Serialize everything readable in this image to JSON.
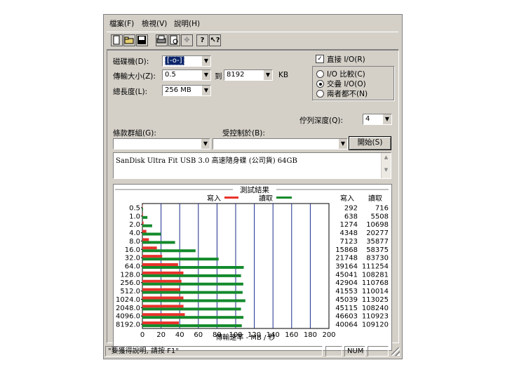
{
  "menu": {
    "file": "檔案(F)",
    "view": "檢視(V)",
    "help": "說明(H)"
  },
  "toolbar": {
    "buttons": [
      {
        "icon": "new-document-icon",
        "glyph": "🗋"
      },
      {
        "icon": "open-folder-icon",
        "glyph": "📂"
      },
      {
        "icon": "save-icon",
        "glyph": "💾"
      },
      {
        "icon": "print-icon",
        "glyph": "🖶"
      },
      {
        "icon": "print-preview-icon",
        "glyph": "🔍"
      },
      {
        "icon": "move-icon",
        "glyph": "✥"
      },
      {
        "icon": "help-icon",
        "glyph": "?"
      },
      {
        "icon": "context-help-icon",
        "glyph": "⁇"
      }
    ]
  },
  "settings": {
    "drive_label": "磁碟機(D):",
    "drive_value": "[-o-]",
    "transfer_size_label": "傳輸大小(Z):",
    "transfer_from": "0.5",
    "to_label": "到",
    "transfer_to": "8192",
    "unit": "KB",
    "total_length_label": "總長度(L):",
    "total_length": "256 MB",
    "direct_io_label": "直接 I/O(R)",
    "direct_io_checked": true,
    "radio_compare": "I/O 比較(C)",
    "radio_overlap": "交疊 I/O(O)",
    "radio_neither": "兩者都不(N)",
    "selected_radio": "overlap",
    "queue_depth_label": "佇列深度(Q):",
    "queue_depth": "4",
    "group_label": "條款群組(G):",
    "controlled_label": "受控制於(B):",
    "start_button": "開始(S)"
  },
  "description": "SanDisk Ultra Fit USB 3.0 高速隨身碟 (公司貨) 64GB",
  "results": {
    "title": "測試結果",
    "legend_write": "寫入",
    "legend_read": "讀取",
    "col_write": "寫入",
    "col_read": "讀取",
    "write_color": "#e8322a",
    "read_color": "#138a2b"
  },
  "chart_data": {
    "type": "bar",
    "orientation": "horizontal",
    "title": "測試結果",
    "xlabel": "傳輸速率 - MB / 秒",
    "xlim": [
      0,
      200
    ],
    "xticks": [
      0,
      20,
      40,
      60,
      80,
      100,
      120,
      140,
      160,
      180,
      200
    ],
    "categories": [
      "0.5",
      "1.0",
      "2.0",
      "4.0",
      "8.0",
      "16.0",
      "32.0",
      "64.0",
      "128.0",
      "256.0",
      "512.0",
      "1024.0",
      "2048.0",
      "4096.0",
      "8192.0"
    ],
    "series": [
      {
        "name": "寫入",
        "values": [
          292,
          638,
          1274,
          4348,
          7123,
          15868,
          21748,
          39164,
          45041,
          42904,
          41553,
          45039,
          45115,
          46603,
          40064
        ]
      },
      {
        "name": "讀取",
        "values": [
          716,
          5508,
          10698,
          20277,
          35877,
          58375,
          83730,
          111254,
          108281,
          110768,
          110014,
          113025,
          108240,
          110923,
          109120
        ]
      }
    ]
  },
  "statusbar": {
    "text": "\"要獲得說明, 請按 F1\"",
    "num": "NUM"
  }
}
